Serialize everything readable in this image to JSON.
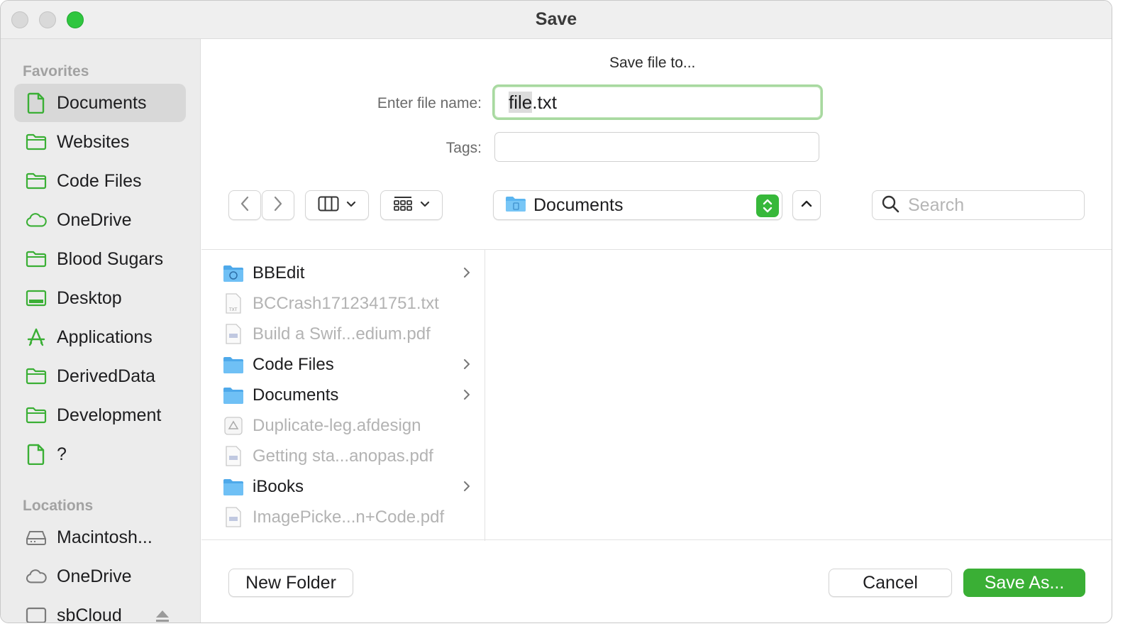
{
  "window": {
    "title": "Save"
  },
  "colors": {
    "accent": "#3aaf35",
    "sidebar_icon": "#3aaf35",
    "folder_blue": "#5bb5f0"
  },
  "sidebar": {
    "favorites_label": "Favorites",
    "favorites": [
      {
        "label": "Documents",
        "icon": "document-icon",
        "selected": true
      },
      {
        "label": "Websites",
        "icon": "folder-icon"
      },
      {
        "label": "Code Files",
        "icon": "folder-icon"
      },
      {
        "label": "OneDrive",
        "icon": "cloud-icon"
      },
      {
        "label": "Blood Sugars",
        "icon": "folder-icon"
      },
      {
        "label": "Desktop",
        "icon": "desktop-icon"
      },
      {
        "label": "Applications",
        "icon": "applications-icon"
      },
      {
        "label": "DerivedData",
        "icon": "folder-icon"
      },
      {
        "label": "Development",
        "icon": "folder-icon"
      },
      {
        "label": "?",
        "icon": "document-icon"
      }
    ],
    "locations_label": "Locations",
    "locations": [
      {
        "label": "Macintosh...",
        "icon": "disk-icon"
      },
      {
        "label": "OneDrive",
        "icon": "cloud-icon"
      },
      {
        "label": "sbCloud",
        "icon": "drive-icon"
      }
    ]
  },
  "form": {
    "prompt": "Save file to...",
    "filename_label": "Enter file name:",
    "filename_selected": "file",
    "filename_rest": ".txt",
    "tags_label": "Tags:",
    "tags_value": ""
  },
  "toolbar": {
    "location": "Documents",
    "search_placeholder": "Search"
  },
  "files": [
    {
      "name": "BBEdit",
      "icon": "app-folder-icon",
      "folder": true,
      "enabled": true
    },
    {
      "name": "BCCrash1712341751.txt",
      "icon": "txt-file-icon",
      "folder": false,
      "enabled": false
    },
    {
      "name": "Build a Swif...edium.pdf",
      "icon": "pdf-file-icon",
      "folder": false,
      "enabled": false
    },
    {
      "name": "Code Files",
      "icon": "folder-icon",
      "folder": true,
      "enabled": true
    },
    {
      "name": "Documents",
      "icon": "folder-icon",
      "folder": true,
      "enabled": true
    },
    {
      "name": "Duplicate-leg.afdesign",
      "icon": "afdesign-file-icon",
      "folder": false,
      "enabled": false
    },
    {
      "name": "Getting sta...anopas.pdf",
      "icon": "pdf-file-icon",
      "folder": false,
      "enabled": false
    },
    {
      "name": "iBooks",
      "icon": "folder-icon",
      "folder": true,
      "enabled": true
    },
    {
      "name": "ImagePicke...n+Code.pdf",
      "icon": "pdf-file-icon",
      "folder": false,
      "enabled": false
    }
  ],
  "footer": {
    "new_folder": "New Folder",
    "cancel": "Cancel",
    "save_as": "Save As..."
  }
}
